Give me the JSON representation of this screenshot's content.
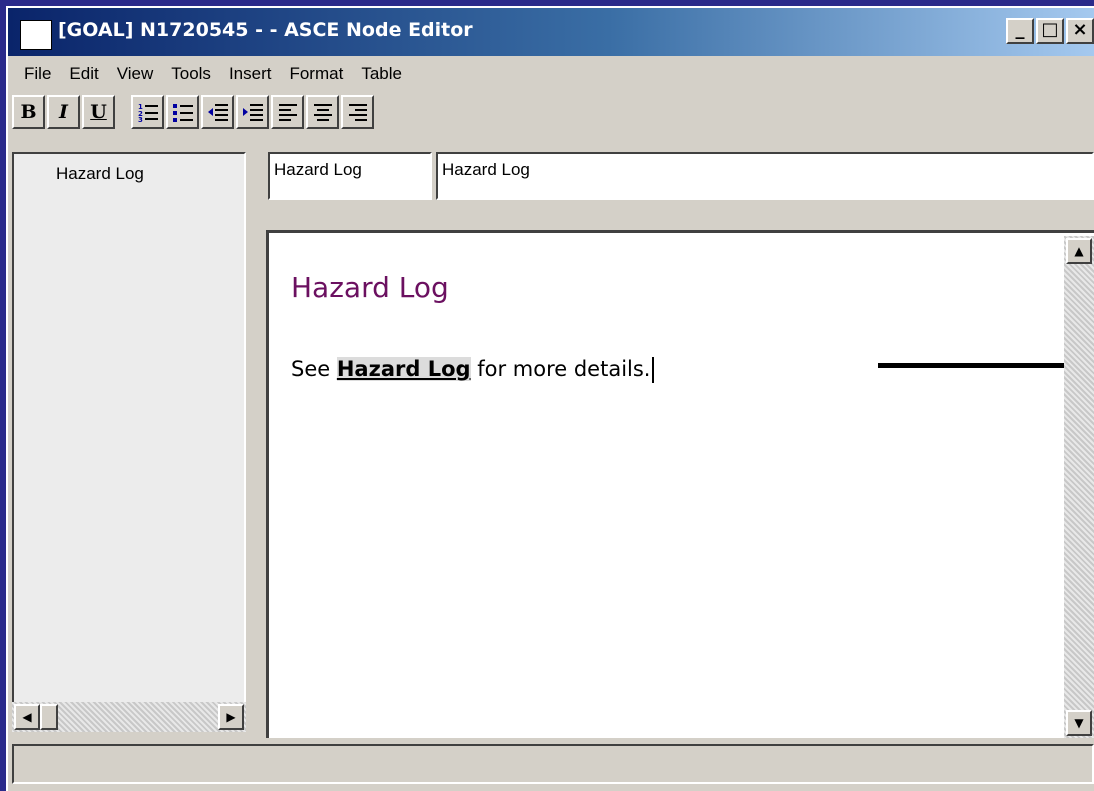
{
  "window": {
    "title": "[GOAL] N1720545 -  - ASCE Node Editor",
    "controls": {
      "minimize": "_",
      "maximize": "□",
      "close": "×"
    }
  },
  "menu": [
    "File",
    "Edit",
    "View",
    "Tools",
    "Insert",
    "Format",
    "Table"
  ],
  "toolbar": {
    "bold": "B",
    "italic": "I",
    "underline": "U",
    "numbered_list": "☰",
    "bullet_list": "☰",
    "outdent": "⇤",
    "indent": "⇥",
    "align_left": "≡",
    "align_center": "≡",
    "align_right": "≡"
  },
  "tree": {
    "items": [
      {
        "label": "Hazard Log"
      }
    ]
  },
  "fields": {
    "identifier": "Hazard Log",
    "title": "Hazard Log"
  },
  "document": {
    "heading": "Hazard Log",
    "text_before": "See ",
    "link": "Hazard Log",
    "text_after": " for more details."
  },
  "colors": {
    "heading": "#6b1060",
    "desktop": "#2a2a8a",
    "titlebar_start": "#0a246a"
  }
}
